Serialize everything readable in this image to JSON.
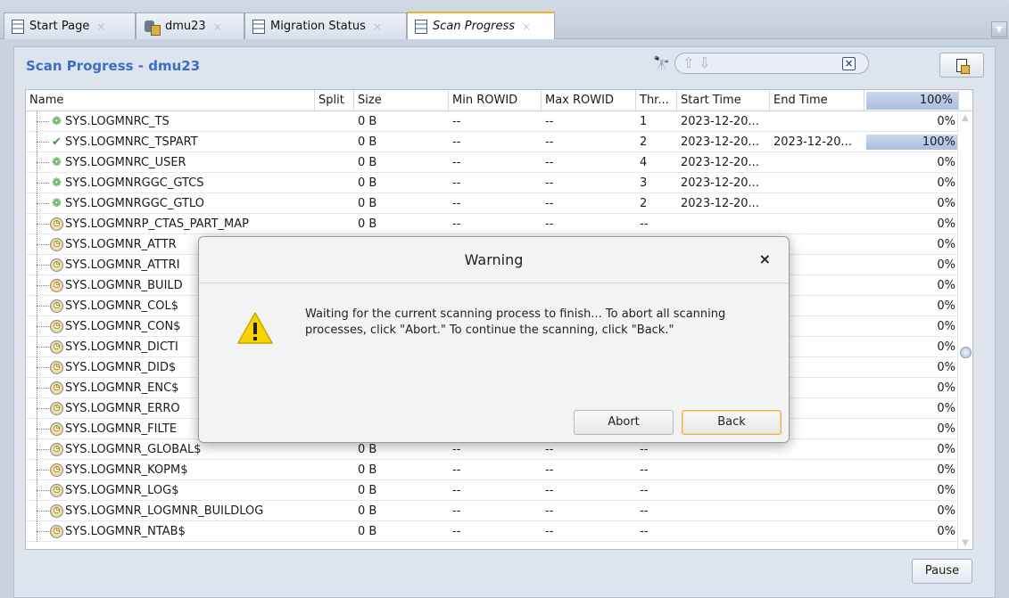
{
  "tabs": [
    {
      "label": "Start Page",
      "icon": "document-icon",
      "active": false
    },
    {
      "label": "dmu23",
      "icon": "database-connection-icon",
      "active": false
    },
    {
      "label": "Migration Status",
      "icon": "document-icon",
      "active": false
    },
    {
      "label": "Scan Progress",
      "icon": "document-icon",
      "active": true
    }
  ],
  "tab_close_glyph": "×",
  "panel": {
    "title": "Scan Progress - dmu23",
    "find_icon": "binoculars-icon",
    "find_up_icon": "arrow-up-icon",
    "find_down_icon": "arrow-down-icon",
    "find_clear_icon": "clear-icon",
    "export_icon": "export-icon",
    "pause_label": "Pause"
  },
  "table": {
    "columns": [
      "Name",
      "Split",
      "Size",
      "Min ROWID",
      "Max ROWID",
      "Thr...",
      "Start Time",
      "End Time",
      "100%"
    ],
    "header_progress": 1.0,
    "rows": [
      {
        "status": "running",
        "name": "SYS.LOGMNRC_TS",
        "split": "",
        "size": "0 B",
        "min": "--",
        "max": "--",
        "thr": "1",
        "start": "2023-12-20...",
        "end": "",
        "pct": "0%",
        "progress": 0
      },
      {
        "status": "done",
        "name": "SYS.LOGMNRC_TSPART",
        "split": "",
        "size": "0 B",
        "min": "--",
        "max": "--",
        "thr": "2",
        "start": "2023-12-20...",
        "end": "2023-12-20...",
        "pct": "100%",
        "progress": 1.0
      },
      {
        "status": "running",
        "name": "SYS.LOGMNRC_USER",
        "split": "",
        "size": "0 B",
        "min": "--",
        "max": "--",
        "thr": "4",
        "start": "2023-12-20...",
        "end": "",
        "pct": "0%",
        "progress": 0
      },
      {
        "status": "running",
        "name": "SYS.LOGMNRGGC_GTCS",
        "split": "",
        "size": "0 B",
        "min": "--",
        "max": "--",
        "thr": "3",
        "start": "2023-12-20...",
        "end": "",
        "pct": "0%",
        "progress": 0
      },
      {
        "status": "running",
        "name": "SYS.LOGMNRGGC_GTLO",
        "split": "",
        "size": "0 B",
        "min": "--",
        "max": "--",
        "thr": "2",
        "start": "2023-12-20...",
        "end": "",
        "pct": "0%",
        "progress": 0
      },
      {
        "status": "pending",
        "name": "SYS.LOGMNRP_CTAS_PART_MAP",
        "split": "",
        "size": "0 B",
        "min": "--",
        "max": "--",
        "thr": "--",
        "start": "",
        "end": "",
        "pct": "0%",
        "progress": 0
      },
      {
        "status": "pending",
        "name": "SYS.LOGMNR_ATTR",
        "split": "",
        "size": "",
        "min": "",
        "max": "",
        "thr": "",
        "start": "",
        "end": "",
        "pct": "0%",
        "progress": 0
      },
      {
        "status": "pending",
        "name": "SYS.LOGMNR_ATTRI",
        "split": "",
        "size": "",
        "min": "",
        "max": "",
        "thr": "",
        "start": "",
        "end": "",
        "pct": "0%",
        "progress": 0
      },
      {
        "status": "pending",
        "name": "SYS.LOGMNR_BUILD",
        "split": "",
        "size": "",
        "min": "",
        "max": "",
        "thr": "",
        "start": "",
        "end": "",
        "pct": "0%",
        "progress": 0
      },
      {
        "status": "pending",
        "name": "SYS.LOGMNR_COL$",
        "split": "",
        "size": "",
        "min": "",
        "max": "",
        "thr": "",
        "start": "",
        "end": "",
        "pct": "0%",
        "progress": 0
      },
      {
        "status": "pending",
        "name": "SYS.LOGMNR_CON$",
        "split": "",
        "size": "",
        "min": "",
        "max": "",
        "thr": "",
        "start": "",
        "end": "",
        "pct": "0%",
        "progress": 0
      },
      {
        "status": "pending",
        "name": "SYS.LOGMNR_DICTI",
        "split": "",
        "size": "",
        "min": "",
        "max": "",
        "thr": "",
        "start": "",
        "end": "",
        "pct": "0%",
        "progress": 0
      },
      {
        "status": "pending",
        "name": "SYS.LOGMNR_DID$",
        "split": "",
        "size": "",
        "min": "",
        "max": "",
        "thr": "",
        "start": "",
        "end": "",
        "pct": "0%",
        "progress": 0
      },
      {
        "status": "pending",
        "name": "SYS.LOGMNR_ENC$",
        "split": "",
        "size": "",
        "min": "",
        "max": "",
        "thr": "",
        "start": "",
        "end": "",
        "pct": "0%",
        "progress": 0
      },
      {
        "status": "pending",
        "name": "SYS.LOGMNR_ERRO",
        "split": "",
        "size": "",
        "min": "",
        "max": "",
        "thr": "",
        "start": "",
        "end": "",
        "pct": "0%",
        "progress": 0
      },
      {
        "status": "pending",
        "name": "SYS.LOGMNR_FILTE",
        "split": "",
        "size": "",
        "min": "",
        "max": "",
        "thr": "",
        "start": "",
        "end": "",
        "pct": "0%",
        "progress": 0
      },
      {
        "status": "pending",
        "name": "SYS.LOGMNR_GLOBAL$",
        "split": "",
        "size": "0 B",
        "min": "--",
        "max": "--",
        "thr": "--",
        "start": "",
        "end": "",
        "pct": "0%",
        "progress": 0
      },
      {
        "status": "pending",
        "name": "SYS.LOGMNR_KOPM$",
        "split": "",
        "size": "0 B",
        "min": "--",
        "max": "--",
        "thr": "--",
        "start": "",
        "end": "",
        "pct": "0%",
        "progress": 0
      },
      {
        "status": "pending",
        "name": "SYS.LOGMNR_LOG$",
        "split": "",
        "size": "0 B",
        "min": "--",
        "max": "--",
        "thr": "--",
        "start": "",
        "end": "",
        "pct": "0%",
        "progress": 0
      },
      {
        "status": "pending",
        "name": "SYS.LOGMNR_LOGMNR_BUILDLOG",
        "split": "",
        "size": "0 B",
        "min": "--",
        "max": "--",
        "thr": "--",
        "start": "",
        "end": "",
        "pct": "0%",
        "progress": 0
      },
      {
        "status": "pending",
        "name": "SYS.LOGMNR_NTAB$",
        "split": "",
        "size": "0 B",
        "min": "--",
        "max": "--",
        "thr": "--",
        "start": "",
        "end": "",
        "pct": "0%",
        "progress": 0
      }
    ]
  },
  "status_icons": {
    "running": "gear-icon",
    "done": "checkmark-icon",
    "pending": "clock-icon"
  },
  "dialog": {
    "title": "Warning",
    "close_glyph": "×",
    "icon": "warning-icon",
    "message": "Waiting for the current scanning process to finish... To abort all scanning processes, click \"Abort.\" To continue the scanning, click \"Back.\"",
    "abort_label": "Abort",
    "back_label": "Back"
  },
  "colors": {
    "title_blue": "#3a6fc4",
    "active_tab_accent": "#f0b32a",
    "progress_fill": "#a9bedf",
    "warning_yellow": "#f5d400"
  }
}
